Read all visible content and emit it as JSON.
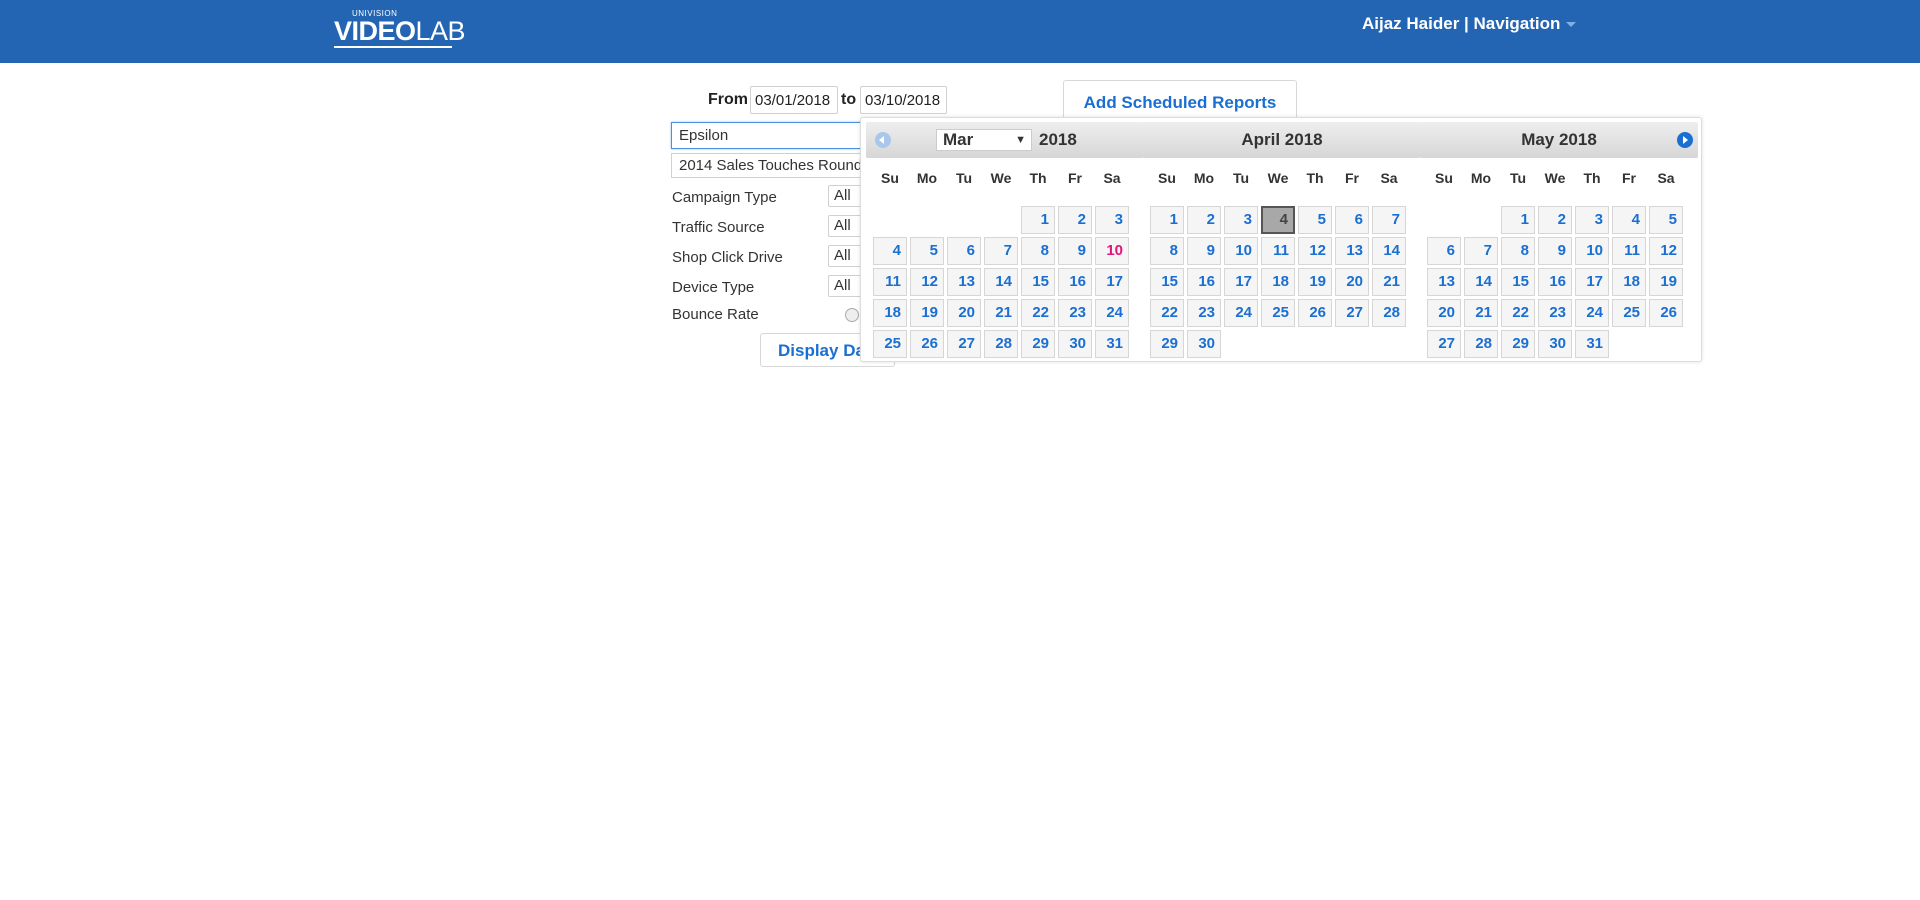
{
  "header": {
    "logo_top": "UNIVISION",
    "logo_bold": "VIDEO",
    "logo_light": "LAB",
    "user_nav": "Aijaz Haider | Navigation"
  },
  "filters": {
    "from_label": "From",
    "from_value": "03/01/2018",
    "to_label": "to",
    "to_value": "03/10/2018",
    "client_value": "Epsilon",
    "campaign_value": "2014 Sales Touches Round",
    "rows": [
      {
        "label": "Campaign Type",
        "value": "All"
      },
      {
        "label": "Traffic Source",
        "value": "All"
      },
      {
        "label": "Shop Click Drive",
        "value": "All"
      },
      {
        "label": "Device Type",
        "value": "All"
      }
    ],
    "bounce_label": "Bounce Rate",
    "display_button": "Display Data",
    "scheduled_button": "Add Scheduled Reports"
  },
  "datepicker": {
    "weekdays": [
      "Su",
      "Mo",
      "Tu",
      "We",
      "Th",
      "Fr",
      "Sa"
    ],
    "months": [
      {
        "select_label": "Mar",
        "year_label": "2018",
        "title": "",
        "first_weekday": 4,
        "days": 31,
        "today": 10,
        "selected": null
      },
      {
        "select_label": "",
        "year_label": "",
        "title": "April 2018",
        "first_weekday": 0,
        "days": 30,
        "today": null,
        "selected": 4
      },
      {
        "select_label": "",
        "year_label": "",
        "title": "May 2018",
        "first_weekday": 2,
        "days": 31,
        "today": null,
        "selected": null
      }
    ]
  }
}
